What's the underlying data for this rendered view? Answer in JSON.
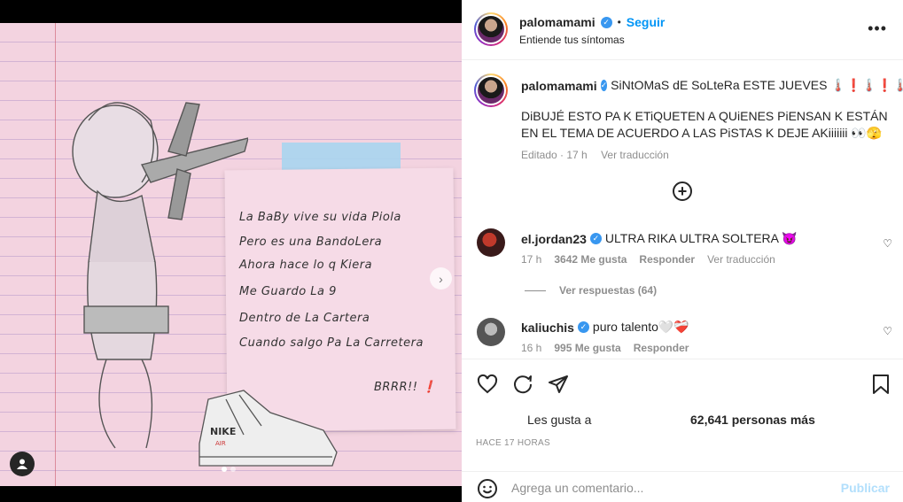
{
  "post": {
    "media": {
      "note_lines": [
        "La BaBy vive su vida Piola",
        "Pero es una BandoLera",
        "Ahora hace lo q Kiera",
        "Me Guardo La 9",
        "Dentro de La Cartera",
        "Cuando salgo Pa La Carretera"
      ],
      "note_signature": "BRRR!! ❗",
      "sneaker_brand": "NIKE",
      "sneaker_sub": "AIR",
      "carousel_dots": 2,
      "carousel_active": 0
    },
    "header": {
      "username": "palomamami",
      "separator": "•",
      "follow_label": "Seguir",
      "subtitle": "Entiende tus síntomas",
      "more_label": "•••"
    },
    "caption": {
      "username": "palomamami",
      "title": "SiNtOMaS dE SoLteRa ESTE JUEVES 🌡️❗🌡️❗🌡️❗",
      "body": "DiBUJÉ ESTO PA K ETiQUETEN A QUiENES PiENSAN K ESTÁN EN EL TEMA DE ACUERDO A LAS PiSTAS K DEJE AKiiiiiii 👀🫣",
      "edited": "Editado · 17 h",
      "translate": "Ver traducción"
    },
    "comments": [
      {
        "username": "el.jordan23",
        "text": "ULTRA RIKA ULTRA SOLTERA 😈",
        "time": "17 h",
        "likes": "3642 Me gusta",
        "reply": "Responder",
        "translate": "Ver traducción",
        "view_replies": "Ver respuestas (64)"
      },
      {
        "username": "kaliuchis",
        "text": "puro talento🤍❤️‍🩹",
        "time": "16 h",
        "likes": "995 Me gusta",
        "reply": "Responder"
      }
    ],
    "likes": {
      "prefix": "Les gusta a",
      "count_label": "62,641 personas más"
    },
    "timestamp": "HACE 17 HORAS",
    "comment_box": {
      "placeholder": "Agrega un comentario...",
      "publish": "Publicar"
    }
  },
  "colors": {
    "accent": "#0095f6",
    "verified": "#3897f0",
    "muted": "#8e8e8e",
    "publish_disabled": "#b2dffc",
    "media_bg": "#f3d3e0"
  },
  "icons": [
    "more-icon",
    "verified-icon",
    "add-circle-icon",
    "heart-icon",
    "comment-icon",
    "share-icon",
    "bookmark-icon",
    "emoji-icon",
    "chevron-right-icon",
    "user-tag-icon"
  ]
}
